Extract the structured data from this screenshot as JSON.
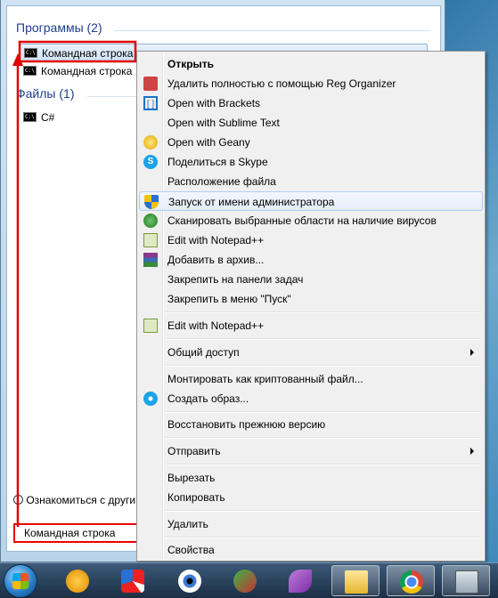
{
  "start_menu": {
    "programs_header": "Программы (2)",
    "programs": [
      {
        "label": "Командная строка",
        "icon": "cmd-icon"
      },
      {
        "label": "Командная строка",
        "icon": "cmd-icon"
      }
    ],
    "files_header": "Файлы (1)",
    "files": [
      {
        "label": "C#",
        "icon": "cmd-icon"
      }
    ],
    "see_more": "Ознакомиться с други",
    "search_value": "Командная строка"
  },
  "context_menu": {
    "items": [
      {
        "label": "Открыть",
        "bold": true
      },
      {
        "label": "Удалить полностью с помощью Reg Organizer",
        "icon": "reg-organizer-icon"
      },
      {
        "label": "Open with Brackets",
        "icon": "brackets-icon"
      },
      {
        "label": "Open with Sublime Text"
      },
      {
        "label": "Open with Geany",
        "icon": "geany-icon"
      },
      {
        "label": "Поделиться в Skype",
        "icon": "skype-icon"
      },
      {
        "label": "Расположение файла"
      },
      {
        "label": "Запуск от имени администратора",
        "icon": "uac-shield-icon"
      },
      {
        "label": "Сканировать выбранные области на наличие вирусов",
        "icon": "antivirus-icon"
      },
      {
        "label": "Edit with Notepad++",
        "icon": "notepadpp-icon"
      },
      {
        "label": "Добавить в архив...",
        "icon": "winrar-icon"
      },
      {
        "label": "Закрепить на панели задач"
      },
      {
        "label": "Закрепить в меню \"Пуск\""
      },
      {
        "label": "Edit with Notepad++",
        "icon": "notepadpp-icon"
      },
      {
        "label": "Общий доступ",
        "submenu": true
      },
      {
        "label": "Монтировать как криптованный файл..."
      },
      {
        "label": "Создать образ...",
        "icon": "disc-image-icon"
      },
      {
        "label": "Восстановить прежнюю версию"
      },
      {
        "label": "Отправить",
        "submenu": true
      },
      {
        "label": "Вырезать"
      },
      {
        "label": "Копировать"
      },
      {
        "label": "Удалить"
      },
      {
        "label": "Свойства"
      }
    ]
  },
  "taskbar": {
    "items": [
      "start-orb-icon",
      "aimp-icon",
      "paint-icon",
      "eye-app-icon",
      "vector-app-icon",
      "feather-app-icon",
      "file-explorer-icon",
      "chrome-icon",
      "calculator-icon"
    ]
  },
  "colors": {
    "annotation_red": "#e00000",
    "header_blue": "#1e3f8a",
    "highlight_border": "#aecff7"
  }
}
